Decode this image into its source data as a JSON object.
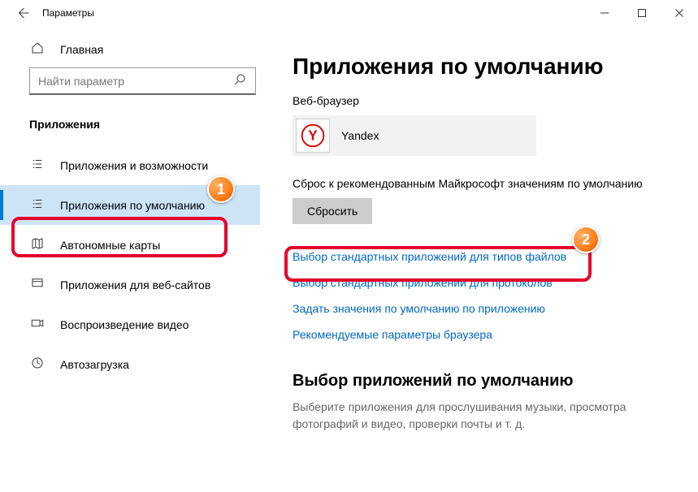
{
  "window": {
    "title": "Параметры"
  },
  "sidebar": {
    "home": "Главная",
    "search_placeholder": "Найти параметр",
    "section": "Приложения",
    "items": [
      {
        "label": "Приложения и возможности"
      },
      {
        "label": "Приложения по умолчанию"
      },
      {
        "label": "Автономные карты"
      },
      {
        "label": "Приложения для веб-сайтов"
      },
      {
        "label": "Воспроизведение видео"
      },
      {
        "label": "Автозагрузка"
      }
    ]
  },
  "main": {
    "heading": "Приложения по умолчанию",
    "browser_label": "Веб-браузер",
    "browser_app": "Yandex",
    "reset_text": "Сброс к рекомендованным Майкрософт значениям по умолчанию",
    "reset_btn": "Сбросить",
    "links": [
      "Выбор стандартных приложений для типов файлов",
      "Выбор стандартных приложений для протоколов",
      "Задать значения по умолчанию по приложению",
      "Рекомендуемые параметры браузера"
    ],
    "section2_title": "Выбор приложений по умолчанию",
    "section2_desc": "Выберите приложения для прослушивания музыки, просмотра фотографий и видео, проверки почты и т. д."
  },
  "annotations": {
    "step1": "1",
    "step2": "2"
  }
}
